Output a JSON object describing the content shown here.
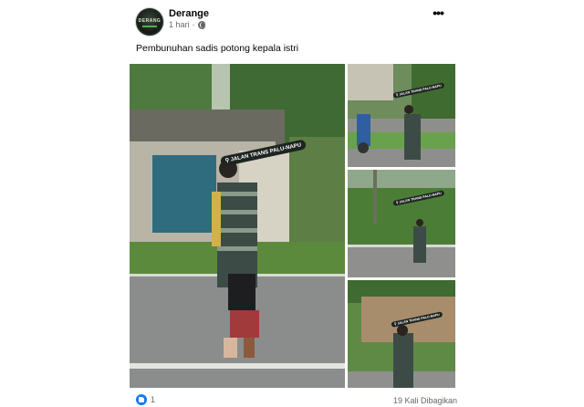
{
  "post": {
    "author": "Derange",
    "avatar_text": "DERANG",
    "time": "1 hari",
    "separator": "·",
    "privacy_icon": "globe-icon",
    "more_icon": "more-horizontal-icon",
    "more_label": "•••",
    "caption": "Pembunuhan sadis potong kepala istri"
  },
  "media": {
    "location_tag": "JALAN TRANS PALU-NAPU",
    "pin_icon": "location-pin-icon"
  },
  "footer": {
    "reaction_icon": "like-icon",
    "reaction_count": "1",
    "shares": "19 Kali Dibagikan"
  },
  "colors": {
    "link_blue": "#1877f2",
    "meta_grey": "#65676b",
    "tag_bg": "#1d2421"
  }
}
